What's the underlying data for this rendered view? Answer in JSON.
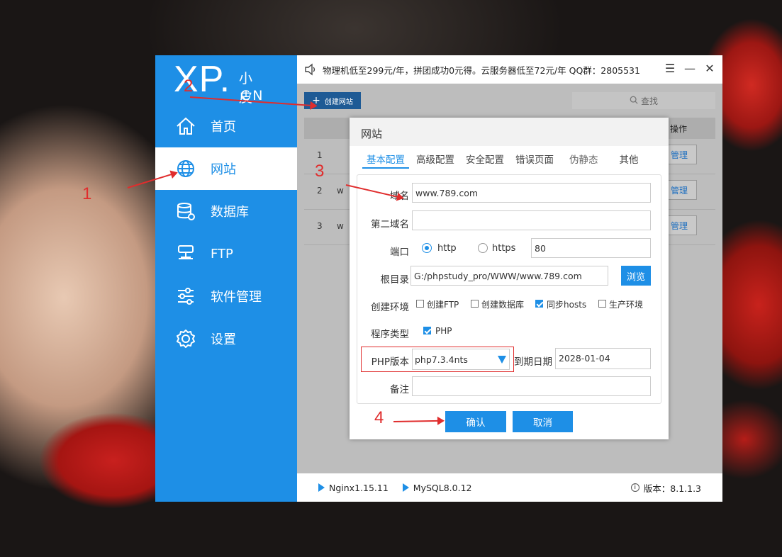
{
  "logo": {
    "mark": "XP.",
    "cn_top": "小皮",
    "cn_bottom": "CN"
  },
  "sidebar": {
    "items": [
      {
        "label": "首页",
        "icon": "home-icon"
      },
      {
        "label": "网站",
        "icon": "globe-icon",
        "active": true
      },
      {
        "label": "数据库",
        "icon": "database-icon"
      },
      {
        "label": "FTP",
        "icon": "ftp-icon"
      },
      {
        "label": "软件管理",
        "icon": "sliders-icon"
      },
      {
        "label": "设置",
        "icon": "gear-icon"
      }
    ]
  },
  "topbar": {
    "notice": "物理机低至299元/年，拼团成功0元得。云服务器低至72元/年  QQ群：2805531",
    "menu_symbol": "☰",
    "minimize_symbol": "—",
    "close_symbol": "✕"
  },
  "content": {
    "create_button": "创建网站",
    "create_plus": "+",
    "search_placeholder": "查找",
    "column_operation": "操作",
    "rows": [
      {
        "num": "1",
        "name": "",
        "action": "管理"
      },
      {
        "num": "2",
        "name": "w",
        "action": "管理"
      },
      {
        "num": "3",
        "name": "w",
        "action": "管理"
      }
    ]
  },
  "dialog": {
    "title": "网站",
    "tabs": [
      "基本配置",
      "高级配置",
      "安全配置",
      "错误页面",
      "伪静态",
      "其他"
    ],
    "fields": {
      "domain_label": "域名",
      "domain_value": "www.789.com",
      "second_domain_label": "第二域名",
      "second_domain_value": "",
      "port_label": "端口",
      "http_label": "http",
      "https_label": "https",
      "port_value": "80",
      "root_label": "根目录",
      "root_value": "G:/phpstudy_pro/WWW/www.789.com",
      "browse_button": "浏览",
      "env_label": "创建环境",
      "env_options": [
        {
          "label": "创建FTP",
          "checked": false
        },
        {
          "label": "创建数据库",
          "checked": false
        },
        {
          "label": "同步hosts",
          "checked": true
        },
        {
          "label": "生产环境",
          "checked": false
        }
      ],
      "program_label": "程序类型",
      "program_option": "PHP",
      "php_label": "PHP版本",
      "php_value": "php7.3.4nts",
      "expire_label": "到期日期",
      "expire_value": "2028-01-04",
      "note_label": "备注",
      "note_value": ""
    },
    "confirm_button": "确认",
    "cancel_button": "取消"
  },
  "statusbar": {
    "services": [
      "Nginx1.15.11",
      "MySQL8.0.12"
    ],
    "version": "版本：8.1.1.3"
  },
  "annotations": [
    "1",
    "2",
    "3",
    "4"
  ],
  "colors": {
    "accent": "#1e8fe6",
    "annotation": "#e02d2d"
  }
}
